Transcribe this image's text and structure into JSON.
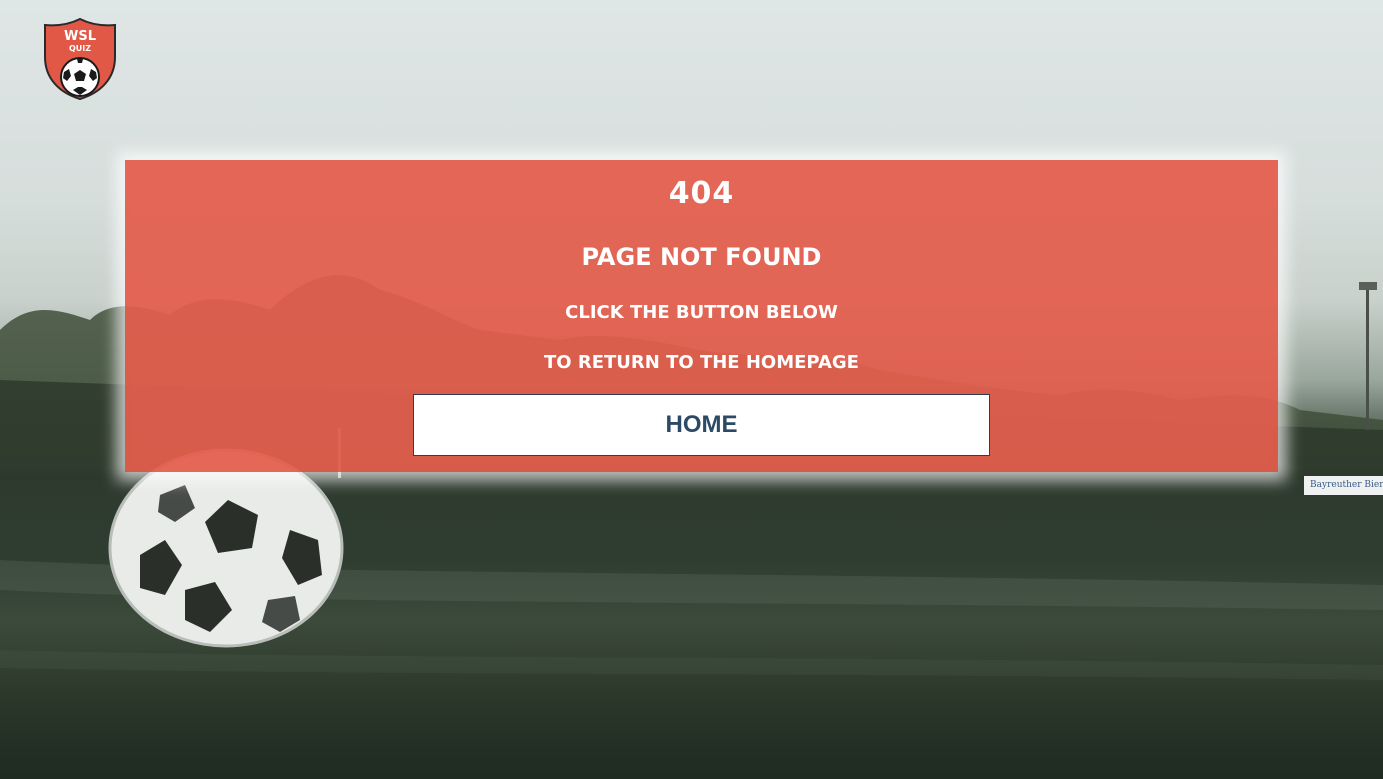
{
  "logo": {
    "line1": "WSL",
    "line2": "QUIZ",
    "icon": "soccer-ball-icon",
    "shield_color": "#e25846"
  },
  "error": {
    "code": "404",
    "title": "PAGE NOT FOUND",
    "line1": "CLICK THE BUTTON BELOW",
    "line2": "TO RETURN TO THE HOMEPAGE"
  },
  "home_button": {
    "label": "HOME"
  },
  "background": {
    "sign_text": "Bayreuther Bierbrauerei"
  },
  "colors": {
    "panel": "#e25846",
    "button_text": "#2c4a66",
    "button_bg": "#ffffff"
  }
}
